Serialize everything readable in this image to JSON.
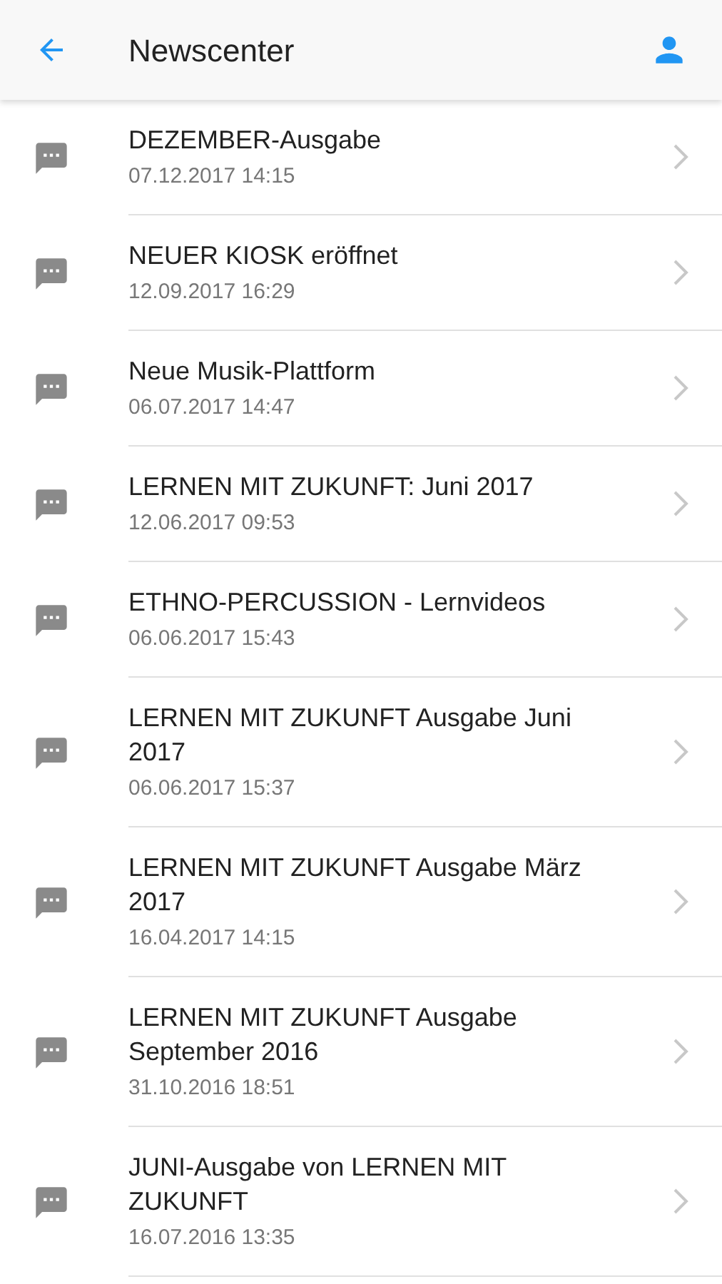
{
  "header": {
    "title": "Newscenter"
  },
  "news": [
    {
      "title": "DEZEMBER-Ausgabe",
      "date": "07.12.2017 14:15"
    },
    {
      "title": "NEUER KIOSK eröffnet",
      "date": "12.09.2017 16:29"
    },
    {
      "title": "Neue Musik-Plattform",
      "date": "06.07.2017 14:47"
    },
    {
      "title": "LERNEN MIT ZUKUNFT: Juni 2017",
      "date": "12.06.2017 09:53"
    },
    {
      "title": "ETHNO-PERCUSSION - Lernvideos",
      "date": "06.06.2017 15:43"
    },
    {
      "title": "LERNEN MIT ZUKUNFT Ausgabe Juni 2017",
      "date": "06.06.2017 15:37"
    },
    {
      "title": "LERNEN MIT ZUKUNFT Ausgabe März 2017",
      "date": "16.04.2017 14:15"
    },
    {
      "title": "LERNEN MIT ZUKUNFT Ausgabe September 2016",
      "date": "31.10.2016 18:51"
    },
    {
      "title": "JUNI-Ausgabe von LERNEN MIT ZUKUNFT",
      "date": "16.07.2016 13:35"
    }
  ]
}
